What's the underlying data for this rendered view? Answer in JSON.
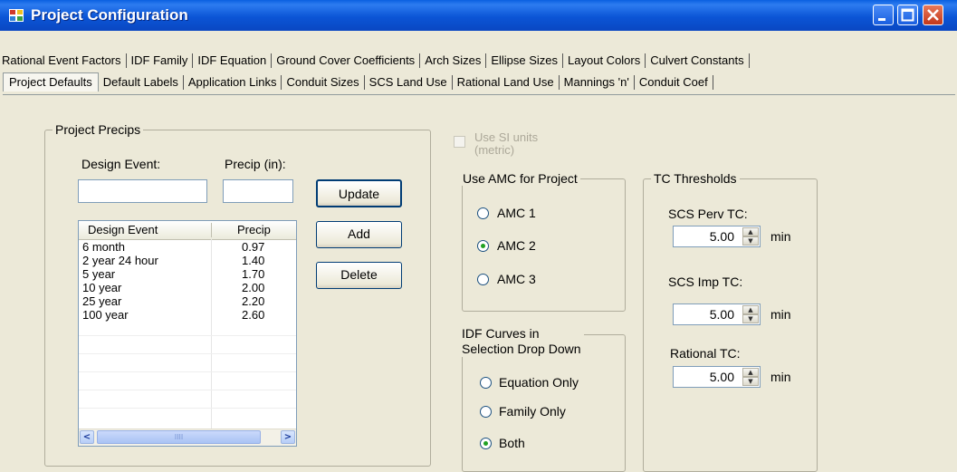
{
  "window": {
    "title": "Project Configuration",
    "icon": "app-grid-icon"
  },
  "tabs_row1": [
    "Rational Event Factors",
    "IDF Family",
    "IDF Equation",
    "Ground Cover Coefficients",
    "Arch Sizes",
    "Ellipse Sizes",
    "Layout Colors",
    "Culvert Constants"
  ],
  "tabs_row2": [
    "Project Defaults",
    "Default Labels",
    "Application Links",
    "Conduit Sizes",
    "SCS Land Use",
    "Rational Land Use",
    "Mannings 'n'",
    "Conduit Coef"
  ],
  "active_tab": "Project Defaults",
  "precips": {
    "group_label": "Project Precips",
    "design_event_label": "Design Event:",
    "precip_label": "Precip (in):",
    "design_event_value": "",
    "precip_value": "",
    "update_label": "Update",
    "add_label": "Add",
    "delete_label": "Delete",
    "columns": [
      "Design Event",
      "Precip"
    ],
    "rows": [
      {
        "event": "6 month",
        "precip": "0.97"
      },
      {
        "event": "2 year 24 hour",
        "precip": "1.40"
      },
      {
        "event": "5 year",
        "precip": "1.70"
      },
      {
        "event": "10 year",
        "precip": "2.00"
      },
      {
        "event": "25 year",
        "precip": "2.20"
      },
      {
        "event": "100 year",
        "precip": "2.60"
      }
    ],
    "scroll_grip": "IIII"
  },
  "si_units": {
    "label_line1": "Use SI units",
    "label_line2": "(metric)",
    "checked": false,
    "enabled": false
  },
  "amc": {
    "group_label": "Use AMC for Project",
    "options": [
      "AMC 1",
      "AMC 2",
      "AMC 3"
    ],
    "selected": "AMC 2"
  },
  "idf": {
    "group_label_line1": "IDF Curves in",
    "group_label_line2": "Selection Drop Down",
    "options": [
      "Equation Only",
      "Family Only",
      "Both"
    ],
    "selected": "Both"
  },
  "tc": {
    "group_label": "TC Thresholds",
    "scs_perv": {
      "label": "SCS Perv TC:",
      "value": "5.00",
      "unit": "min"
    },
    "scs_imp": {
      "label": "SCS Imp TC:",
      "value": "5.00",
      "unit": "min"
    },
    "rational": {
      "label": "Rational TC:",
      "value": "5.00",
      "unit": "min"
    }
  },
  "colors": {
    "title_bar": "#0a55d6",
    "face": "#ece9d8",
    "radio_dot": "#21a121",
    "close": "#c2371a"
  }
}
